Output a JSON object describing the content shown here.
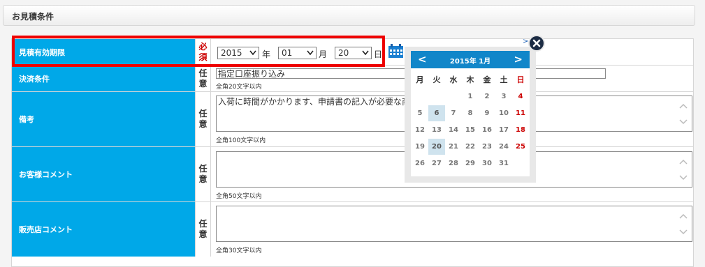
{
  "section": {
    "title": "お見積条件"
  },
  "rows": {
    "expiry": {
      "label": "見積有効期限",
      "req_1": "必",
      "req_2": "須",
      "year": "2015",
      "year_unit": "年",
      "month": "01",
      "month_unit": "月",
      "day": "20",
      "day_unit": "日"
    },
    "payment": {
      "label": "決済条件",
      "req_1": "任",
      "req_2": "意",
      "value": "指定口座振り込み",
      "note": "全角20文字以内"
    },
    "remarks": {
      "label": "備考",
      "req_1": "任",
      "req_2": "意",
      "value": "入荷に時間がかかります、申請書の記入が必要な商",
      "note": "全角100文字以内"
    },
    "customer_comment": {
      "label": "お客様コメント",
      "req_1": "任",
      "req_2": "意",
      "value": "",
      "note": "全角50文字以内"
    },
    "store_comment": {
      "label": "販売店コメント",
      "req_1": "任",
      "req_2": "意",
      "value": "",
      "note": "全角30文字以内"
    }
  },
  "link_marker": ">",
  "calendar": {
    "title": "2015年 1月",
    "prev": "<",
    "next": ">",
    "weekdays": [
      "月",
      "火",
      "水",
      "木",
      "金",
      "土",
      "日"
    ],
    "weeks": [
      [
        "",
        "",
        "",
        "1",
        "2",
        "3",
        "4"
      ],
      [
        "5",
        "6",
        "7",
        "8",
        "9",
        "10",
        "11"
      ],
      [
        "12",
        "13",
        "14",
        "15",
        "16",
        "17",
        "18"
      ],
      [
        "19",
        "20",
        "21",
        "22",
        "23",
        "24",
        "25"
      ],
      [
        "26",
        "27",
        "28",
        "29",
        "30",
        "31",
        ""
      ]
    ],
    "highlighted_days": [
      "6",
      "20"
    ]
  },
  "colors": {
    "label_bg": "#00a8e8",
    "required_red": "#cc0000",
    "highlight_border": "#ee0000",
    "calendar_header": "#1186c9",
    "close_button": "#1c2c44"
  },
  "icons": {
    "calendar": "calendar-icon",
    "close": "close-icon",
    "dropdown": "chevron-down-icon"
  }
}
